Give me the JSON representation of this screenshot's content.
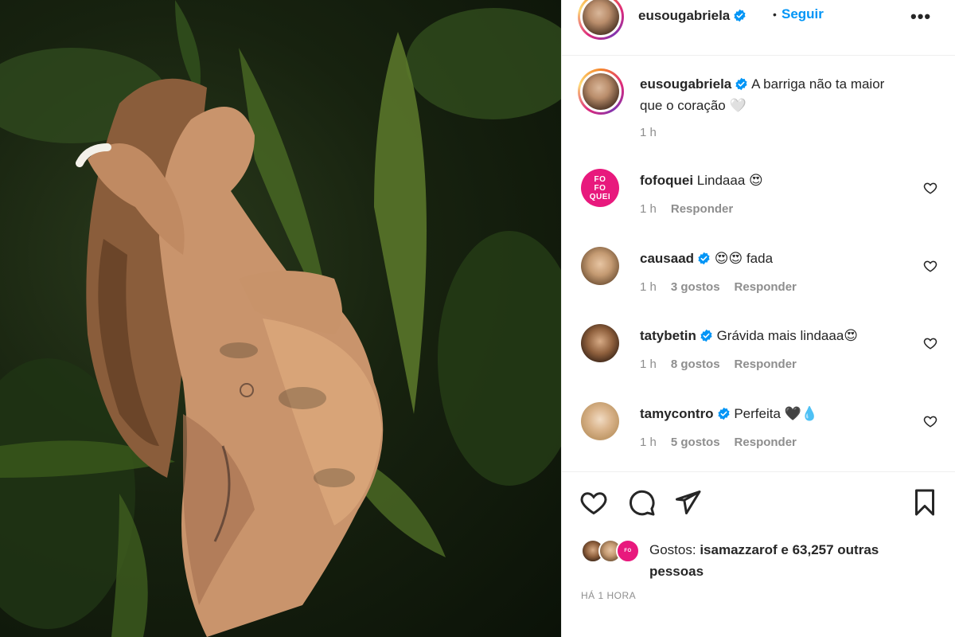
{
  "post": {
    "author": "eusougabriela",
    "follow_label": "Seguir",
    "dot": "•",
    "more_label": "•••",
    "caption_user": "eusougabriela",
    "caption_text": "A barriga não ta maior que o coração 🤍",
    "caption_time": "1 h"
  },
  "comments": [
    {
      "user": "fofoquei",
      "verified": false,
      "text": "Lindaaa 😍",
      "time": "1 h",
      "likes": "",
      "reply": "Responder",
      "avatar_text": "FOFOQUEI"
    },
    {
      "user": "causaad",
      "verified": true,
      "text": "😍😍 fada",
      "time": "1 h",
      "likes": "3 gostos",
      "reply": "Responder"
    },
    {
      "user": "tatybetin",
      "verified": true,
      "text": "Grávida mais lindaaa😍",
      "time": "1 h",
      "likes": "8 gostos",
      "reply": "Responder"
    },
    {
      "user": "tamycontro",
      "verified": true,
      "text": "Perfeita 🖤💧",
      "time": "1 h",
      "likes": "5 gostos",
      "reply": "Responder"
    }
  ],
  "actions": {
    "like_icon": "heart-icon",
    "comment_icon": "comment-icon",
    "share_icon": "send-icon",
    "save_icon": "bookmark-icon"
  },
  "likes": {
    "prefix": "Gostos:",
    "user": "isamazzarof",
    "suffix": "e 63,257 outras pessoas"
  },
  "timestamp": "HÁ 1 HORA",
  "colors": {
    "link": "#0095f6",
    "muted": "#8e8e8e",
    "text": "#262626",
    "brand_pink": "#e8197d"
  }
}
